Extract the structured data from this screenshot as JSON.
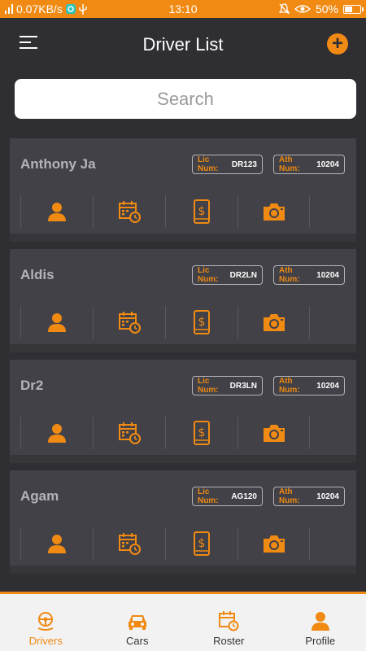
{
  "status_bar": {
    "network_speed": "0.07KB/s",
    "time": "13:10",
    "battery": "50%",
    "battery_level": 0.5
  },
  "header": {
    "title": "Driver List",
    "add_label": "+"
  },
  "search": {
    "placeholder": "Search"
  },
  "badge_labels": {
    "lic": "Lic Num:",
    "ath": "Ath Num:"
  },
  "drivers": [
    {
      "name": "Anthony Ja",
      "lic_num": "DR123",
      "ath_num": "10204"
    },
    {
      "name": "Aldis",
      "lic_num": "DR2LN",
      "ath_num": "10204"
    },
    {
      "name": "Dr2",
      "lic_num": "DR3LN",
      "ath_num": "10204"
    },
    {
      "name": "Agam",
      "lic_num": "AG120",
      "ath_num": "10204"
    }
  ],
  "bottom_nav": {
    "items": [
      {
        "label": "Drivers",
        "icon": "steering-wheel-icon",
        "active": true
      },
      {
        "label": "Cars",
        "icon": "car-icon",
        "active": false
      },
      {
        "label": "Roster",
        "icon": "calendar-clock-icon",
        "active": false
      },
      {
        "label": "Profile",
        "icon": "user-icon",
        "active": false
      }
    ]
  },
  "colors": {
    "accent": "#f08a13",
    "background": "#2e2e33",
    "card": "#414147"
  }
}
